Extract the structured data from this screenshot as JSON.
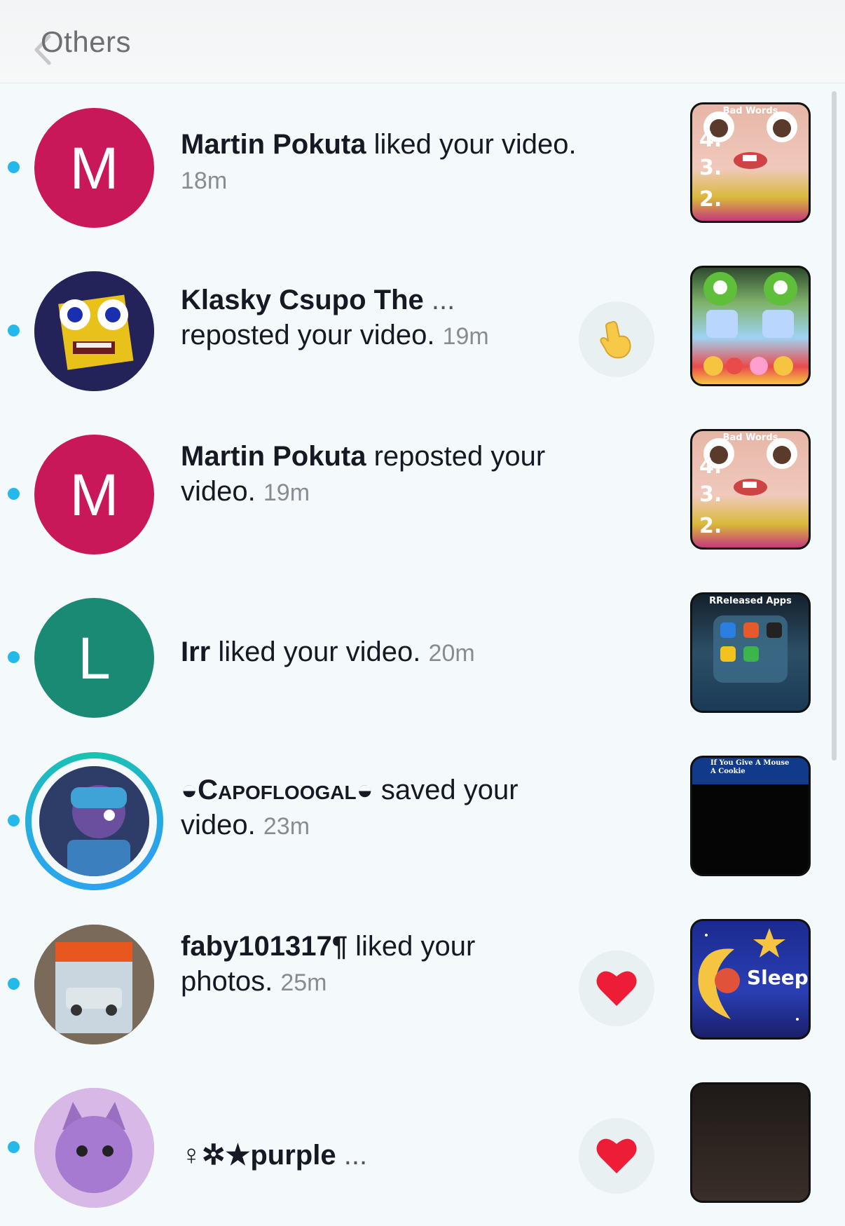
{
  "header": {
    "title": "Others"
  },
  "colors": {
    "unread_dot": "#25b8ea",
    "avatar_m": "#c8185a",
    "avatar_l": "#1a8a74"
  },
  "notifications": [
    {
      "name": "Martin Pokuta",
      "action": " liked your video.",
      "time": "18m",
      "avatar_letter": "M",
      "thumb_caption": "Bad Words"
    },
    {
      "name": "Klasky Csupo The",
      "ellipsis": " ...",
      "action": "reposted your video.",
      "time": "19m",
      "action_icon": "pointing-hand-icon",
      "thumb_caption": ""
    },
    {
      "name": "Martin Pokuta",
      "action": " reposted your video.",
      "time": "19m",
      "avatar_letter": "M",
      "thumb_caption": "Bad Words"
    },
    {
      "name": "Irr",
      "action": " liked your video.",
      "time": "20m",
      "avatar_letter": "L",
      "thumb_caption": "RReleased Apps"
    },
    {
      "name": "◒Capofloogal◒",
      "action": " saved your video.",
      "time": "23m",
      "thumb_caption": "If You Give A Mouse A Cookie"
    },
    {
      "name": "faby101317¶",
      "action": " liked your photos.",
      "time": "25m",
      "action_icon": "heart-icon",
      "thumb_caption": "Sleep Dream"
    },
    {
      "name": "♀✲★purple",
      "ellipsis": " ...",
      "action": "",
      "time": "",
      "action_icon": "heart-icon",
      "thumb_caption": ""
    }
  ]
}
